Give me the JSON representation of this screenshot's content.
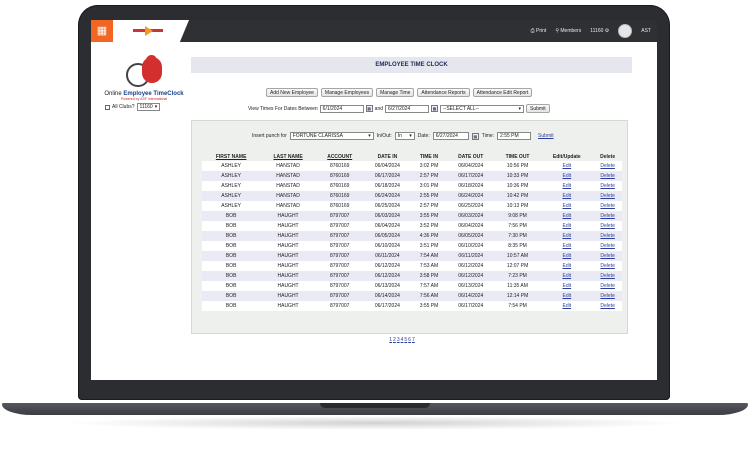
{
  "topbar": {
    "menu_icon": "grid-icon",
    "nav": [
      {
        "label": "Print",
        "icon": "printer-icon"
      },
      {
        "label": "Members",
        "icon": "search-users-icon"
      },
      {
        "label": "11160",
        "icon": "gear-icon"
      },
      {
        "label": "AST",
        "icon": "avatar"
      }
    ]
  },
  "logo": {
    "title_plain": "Online ",
    "title_bold": "Employee TimeClock",
    "sub": "Powered by ASF International"
  },
  "clubs": {
    "label": "All Clubs?",
    "selected": "11160"
  },
  "page": {
    "title": "EMPLOYEE TIME CLOCK"
  },
  "actions": [
    "Add New Employee",
    "Manage Employees",
    "Manage Time",
    "Attendance Reports",
    "Attendance Edit Report"
  ],
  "date_filter": {
    "label": "View Times For Dates Between",
    "from": "6/1/2024",
    "and_label": "and",
    "to": "6/27/2024",
    "employee_select": "--SELECT ALL--",
    "submit": "Submit"
  },
  "insert": {
    "label": "Insert punch for",
    "employee": "FORTUNE CLARISSA",
    "inout_label": "In/Out:",
    "inout": "In",
    "date_label": "Date:",
    "date": "6/27/2024",
    "time_label": "Time:",
    "time": "2:55 PM",
    "submit": "Submit"
  },
  "table": {
    "headers": [
      "FIRST NAME",
      "LAST NAME",
      "ACCOUNT",
      "DATE IN",
      "TIME IN",
      "DATE OUT",
      "TIME OUT",
      "Edit/Update",
      "Delete"
    ],
    "edit_label": "Edit",
    "delete_label": "Delete",
    "rows": [
      [
        "ASHLEY",
        "HANSTAD",
        "8760169",
        "06/04/2024",
        "3:02 PM",
        "06/04/2024",
        "10:56 PM"
      ],
      [
        "ASHLEY",
        "HANSTAD",
        "8760169",
        "06/17/2024",
        "2:57 PM",
        "06/17/2024",
        "10:33 PM"
      ],
      [
        "ASHLEY",
        "HANSTAD",
        "8760169",
        "06/18/2024",
        "3:01 PM",
        "06/18/2024",
        "10:36 PM"
      ],
      [
        "ASHLEY",
        "HANSTAD",
        "8760169",
        "06/24/2024",
        "2:55 PM",
        "06/24/2024",
        "10:42 PM"
      ],
      [
        "ASHLEY",
        "HANSTAD",
        "8760169",
        "06/25/2024",
        "2:57 PM",
        "06/25/2024",
        "10:13 PM"
      ],
      [
        "BOB",
        "HAUGHT",
        "8797007",
        "06/03/2024",
        "3:55 PM",
        "06/03/2024",
        "9:08 PM"
      ],
      [
        "BOB",
        "HAUGHT",
        "8797007",
        "06/04/2024",
        "3:52 PM",
        "06/04/2024",
        "7:56 PM"
      ],
      [
        "BOB",
        "HAUGHT",
        "8797007",
        "06/05/2024",
        "4:36 PM",
        "06/05/2024",
        "7:30 PM"
      ],
      [
        "BOB",
        "HAUGHT",
        "8797007",
        "06/10/2024",
        "3:51 PM",
        "06/10/2024",
        "8:35 PM"
      ],
      [
        "BOB",
        "HAUGHT",
        "8797007",
        "06/11/2024",
        "7:54 AM",
        "06/11/2024",
        "10:57 AM"
      ],
      [
        "BOB",
        "HAUGHT",
        "8797007",
        "06/12/2024",
        "7:53 AM",
        "06/12/2024",
        "12:07 PM"
      ],
      [
        "BOB",
        "HAUGHT",
        "8797007",
        "06/12/2024",
        "3:58 PM",
        "06/12/2024",
        "7:23 PM"
      ],
      [
        "BOB",
        "HAUGHT",
        "8797007",
        "06/13/2024",
        "7:57 AM",
        "06/13/2024",
        "11:35 AM"
      ],
      [
        "BOB",
        "HAUGHT",
        "8797007",
        "06/14/2024",
        "7:56 AM",
        "06/14/2024",
        "12:14 PM"
      ],
      [
        "BOB",
        "HAUGHT",
        "8797007",
        "06/17/2024",
        "3:55 PM",
        "06/17/2024",
        "7:54 PM"
      ]
    ],
    "pages": [
      "1",
      "2",
      "3",
      "4",
      "5",
      "6",
      "7"
    ]
  }
}
